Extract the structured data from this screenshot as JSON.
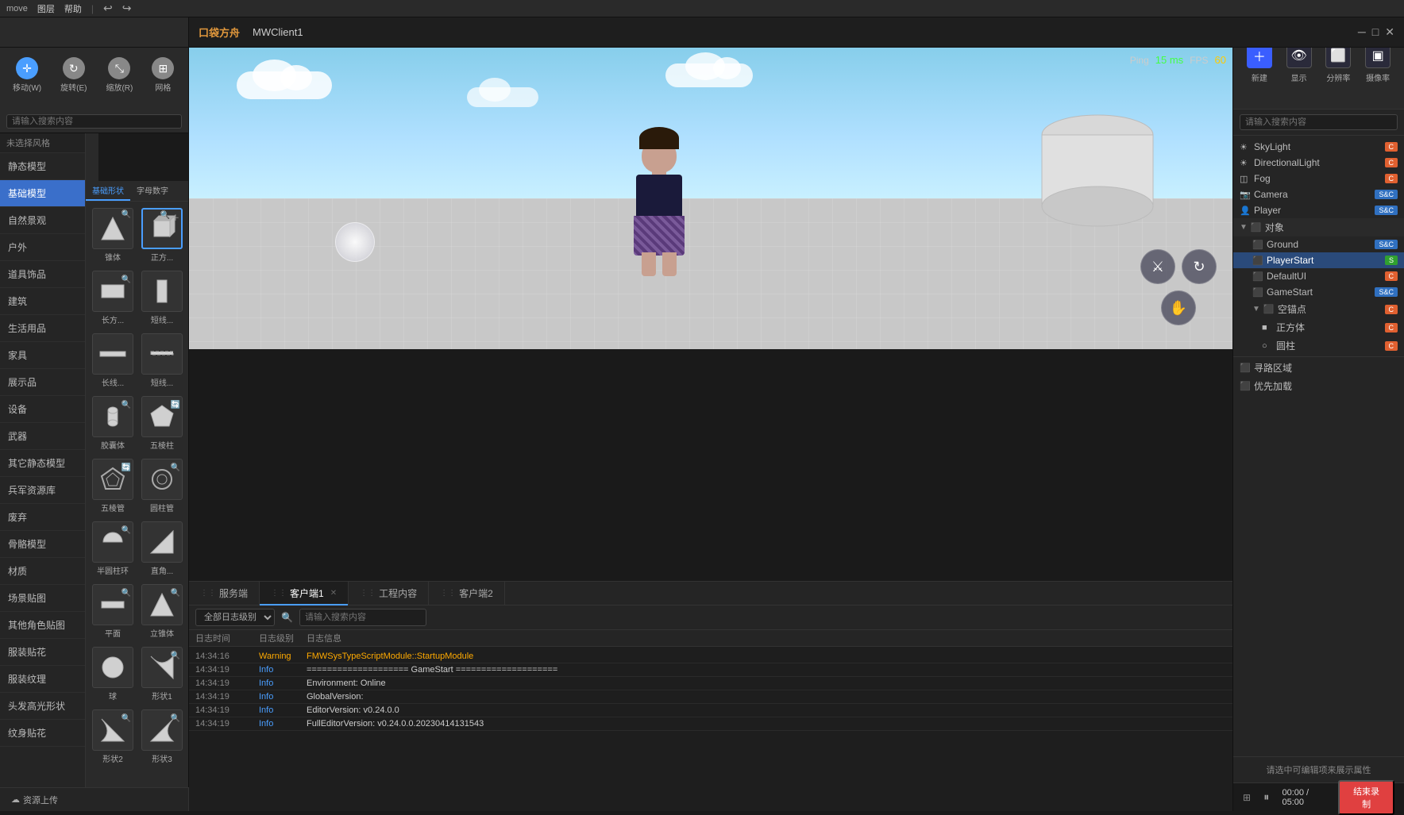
{
  "app": {
    "title": "move",
    "menu": [
      "图层",
      "帮助"
    ],
    "separator": "|",
    "client_title": "MWClient1",
    "logo": "口袋方舟"
  },
  "toolbar": {
    "move_label": "移动(W)",
    "rotate_label": "旋转(E)",
    "scale_label": "缩放(R)",
    "grid_label": "网格"
  },
  "search": {
    "placeholder": "请输入搜索内容"
  },
  "left_panel": {
    "header": "未选择风格",
    "categories": [
      {
        "id": "static",
        "label": "静态模型"
      },
      {
        "id": "basic",
        "label": "基础模型",
        "active": true
      },
      {
        "id": "nature",
        "label": "自然景观"
      },
      {
        "id": "outdoor",
        "label": "户外"
      },
      {
        "id": "road",
        "label": "道具饰品"
      },
      {
        "id": "building",
        "label": "建筑"
      },
      {
        "id": "daily",
        "label": "生活用品"
      },
      {
        "id": "furniture",
        "label": "家具"
      },
      {
        "id": "display",
        "label": "展示品"
      },
      {
        "id": "equipment",
        "label": "设备"
      },
      {
        "id": "weapon",
        "label": "武器"
      },
      {
        "id": "other_static",
        "label": "其它静态模型"
      },
      {
        "id": "army",
        "label": "兵军资源库"
      },
      {
        "id": "trash",
        "label": "废弃"
      },
      {
        "id": "bone",
        "label": "骨骼模型"
      },
      {
        "id": "material",
        "label": "材质"
      },
      {
        "id": "scene_tex",
        "label": "场景贴图"
      },
      {
        "id": "other_char",
        "label": "其他角色贴图"
      },
      {
        "id": "clothing",
        "label": "服装贴花"
      },
      {
        "id": "cloth_tex",
        "label": "服装纹理"
      },
      {
        "id": "hair_shape",
        "label": "头发高光形状"
      },
      {
        "id": "tattoo",
        "label": "纹身贴花"
      }
    ],
    "model_tabs": [
      "基础形状",
      "字母数字"
    ],
    "models": [
      {
        "label": "锥体",
        "shape": "▲"
      },
      {
        "label": "正方...",
        "shape": "■",
        "selected": true
      },
      {
        "label": "长方...",
        "shape": "▬"
      },
      {
        "label": "短线...",
        "shape": "▮"
      },
      {
        "label": "长线...",
        "shape": "━"
      },
      {
        "label": "短线...",
        "shape": "╍"
      },
      {
        "label": "胶囊体",
        "shape": "◉"
      },
      {
        "label": "五棱柱",
        "shape": "⬠"
      },
      {
        "label": "五棱管",
        "shape": "⬡"
      },
      {
        "label": "圆柱管",
        "shape": "○"
      },
      {
        "label": "半圆柱环",
        "shape": "◑"
      },
      {
        "label": "直角...",
        "shape": "◿"
      },
      {
        "label": "平面",
        "shape": "▬"
      },
      {
        "label": "立锥体",
        "shape": "▲"
      },
      {
        "label": "球",
        "shape": "●"
      },
      {
        "label": "形状1",
        "shape": "◤"
      },
      {
        "label": "形状2",
        "shape": "◣"
      },
      {
        "label": "形状3",
        "shape": "◢"
      }
    ]
  },
  "viewport": {
    "ping_label": "Ping",
    "ms_value": "15 ms",
    "fps_label": "FPS",
    "fps_value": "60"
  },
  "right_panel": {
    "toolbar_items": [
      {
        "label": "新建",
        "icon": "＋"
      },
      {
        "label": "显示",
        "icon": "👁"
      },
      {
        "label": "分辨率",
        "icon": "⬜"
      },
      {
        "label": "摄像率",
        "icon": "▣"
      }
    ],
    "search_placeholder": "请输入搜索内容",
    "scene_tree": [
      {
        "label": "SkyLight",
        "indent": 0,
        "badge": "C",
        "badge_type": "badge-c",
        "icon": "☀"
      },
      {
        "label": "DirectionalLight",
        "indent": 0,
        "badge": "C",
        "badge_type": "badge-c",
        "icon": "☀"
      },
      {
        "label": "Fog",
        "indent": 0,
        "badge": "C",
        "badge_type": "badge-c",
        "icon": "◫"
      },
      {
        "label": "Camera",
        "indent": 0,
        "badge": "S&C",
        "badge_type": "badge-sc",
        "icon": "📷"
      },
      {
        "label": "Player",
        "indent": 0,
        "badge": "S&C",
        "badge_type": "badge-sc",
        "icon": "👤"
      },
      {
        "label": "对象",
        "indent": 0,
        "is_section": true,
        "arrow": "▼",
        "icon": "⬛"
      },
      {
        "label": "Ground",
        "indent": 1,
        "badge": "S&C",
        "badge_type": "badge-sc",
        "icon": "⬛"
      },
      {
        "label": "PlayerStart",
        "indent": 1,
        "badge": "S",
        "badge_type": "badge-s",
        "icon": "⬛",
        "selected": true
      },
      {
        "label": "DefaultUI",
        "indent": 1,
        "badge": "C",
        "badge_type": "badge-c",
        "icon": "⬛"
      },
      {
        "label": "GameStart",
        "indent": 1,
        "badge": "S&C",
        "badge_type": "badge-sc",
        "icon": "⬛"
      },
      {
        "label": "空锚点",
        "indent": 1,
        "badge": "C",
        "badge_type": "badge-c",
        "arrow": "▼",
        "icon": "⬛"
      },
      {
        "label": "正方体",
        "indent": 2,
        "badge": "C",
        "badge_type": "badge-c",
        "icon": "■"
      },
      {
        "label": "圆柱",
        "indent": 2,
        "badge": "C",
        "badge_type": "badge-c",
        "icon": "○"
      },
      {
        "label": "寻路区域",
        "indent": 0,
        "icon": "⬛",
        "section": true
      },
      {
        "label": "优先加载",
        "indent": 0,
        "icon": "⬛",
        "section": true
      }
    ],
    "properties_hint": "请选中可编辑项来展示属性",
    "playback": {
      "time": "00:00 / 05:00",
      "record_label": "结束录制"
    }
  },
  "console": {
    "tabs": [
      {
        "label": "服务端",
        "active": false
      },
      {
        "label": "客户端1",
        "active": true
      },
      {
        "label": "工程内容",
        "active": false
      },
      {
        "label": "客户端2",
        "active": false
      }
    ],
    "filter_label": "全部日志级别",
    "search_placeholder": "请输入搜索内容",
    "columns": [
      "日志时间",
      "日志级别",
      "日志信息"
    ],
    "logs": [
      {
        "time": "14:34:16",
        "level": "Warning",
        "level_type": "warning",
        "msg": "FMWSysTypeScriptModule::StartupModule"
      },
      {
        "time": "14:34:19",
        "level": "Info",
        "level_type": "info",
        "msg": "==================== GameStart ===================="
      },
      {
        "time": "14:34:19",
        "level": "Info",
        "level_type": "info",
        "msg": "Environment:    Online"
      },
      {
        "time": "14:34:19",
        "level": "Info",
        "level_type": "info",
        "msg": "GlobalVersion:"
      },
      {
        "time": "14:34:19",
        "level": "Info",
        "level_type": "info",
        "msg": "EditorVersion:  v0.24.0.0"
      },
      {
        "time": "14:34:19",
        "level": "Info",
        "level_type": "info",
        "msg": "FullEditorVersion: v0.24.0.0.20230414131543"
      }
    ]
  },
  "bottom_left": {
    "asset_upload": "资源上传"
  }
}
